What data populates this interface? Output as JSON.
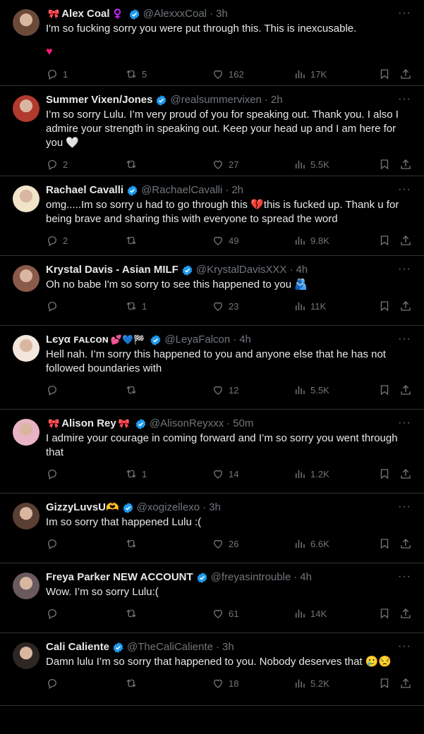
{
  "colors": {
    "background": "#000000",
    "text": "#e7e9ea",
    "muted": "#71767b",
    "verified": "#1d9bf0",
    "divider": "#2f3336",
    "heart": "#f91880"
  },
  "tweets": [
    {
      "pre": "🎀",
      "name": "Alex Coal",
      "post": "♀️",
      "handle": "@AlexxxCoal",
      "dot": "·",
      "time": "3h",
      "text": "I'm so fucking sorry you were put through this. This is inexcusable.",
      "extra": "♥",
      "replies": "1",
      "retweets": "5",
      "likes": "162",
      "views": "17K",
      "avatar": "#6b4a3a"
    },
    {
      "pre": "",
      "name": "Summer Vixen/Jones",
      "post": "",
      "handle": "@realsummervixen",
      "dot": "·",
      "time": "2h",
      "text": "I’m so sorry Lulu. I’m very proud of you for speaking out. Thank you. I also I admire your strength in speaking out. Keep your head up and I am here for you 🤍",
      "extra": "",
      "replies": "2",
      "retweets": "",
      "likes": "27",
      "views": "5.5K",
      "avatar": "#b03a2e"
    },
    {
      "pre": "",
      "name": "Rachael Cavalli",
      "post": "",
      "handle": "@RachaelCavalli",
      "dot": "·",
      "time": "2h",
      "text": "omg.....Im so sorry u had to go through this 💔this is fucked up. Thank u for being brave and sharing this with everyone to spread the word",
      "extra": "",
      "replies": "2",
      "retweets": "",
      "likes": "49",
      "views": "9.8K",
      "avatar": "#f1e4c8"
    },
    {
      "pre": "",
      "name": "Krystal Davis - Asian MILF",
      "post": "",
      "handle": "@KrystalDavisXXX",
      "dot": "·",
      "time": "4h",
      "text": "Oh no babe I'm so sorry to see this happened to you 🫂",
      "extra": "",
      "replies": "",
      "retweets": "1",
      "likes": "23",
      "views": "11K",
      "avatar": "#8a5a4a"
    },
    {
      "pre": "",
      "name": "Lєуα ꜰᴀʟᴄᴏɴ",
      "post": "💕💙🏁",
      "handle": "@LeyaFalcon",
      "dot": "·",
      "time": "4h",
      "text": "Hell nah. I’m sorry this happened to you and anyone else that he has not followed boundaries with",
      "extra": "",
      "replies": "",
      "retweets": "",
      "likes": "12",
      "views": "5.5K",
      "avatar": "#f3e6dc"
    },
    {
      "pre": "🎀",
      "name": "Alison Rey",
      "post": "🎀",
      "handle": "@AlisonReyxxx",
      "dot": "·",
      "time": "50m",
      "text": "I admire your courage in coming forward and I’m so sorry you went through that",
      "extra": "",
      "replies": "",
      "retweets": "1",
      "likes": "14",
      "views": "1.2K",
      "avatar": "#e8b4c4"
    },
    {
      "pre": "",
      "name": "GizzyLuvsU🫶",
      "post": "",
      "handle": "@xogizellexo",
      "dot": "·",
      "time": "3h",
      "text": "Im so sorry that happened Lulu :(",
      "extra": "",
      "replies": "",
      "retweets": "",
      "likes": "26",
      "views": "6.6K",
      "avatar": "#5a4032"
    },
    {
      "pre": "",
      "name": "Freya Parker NEW ACCOUNT",
      "post": "",
      "handle": "@freyasintrouble",
      "dot": "·",
      "time": "4h",
      "text": "Wow. I’m so sorry Lulu:(",
      "extra": "",
      "replies": "",
      "retweets": "",
      "likes": "61",
      "views": "14K",
      "avatar": "#6a5a5e"
    },
    {
      "pre": "",
      "name": "Cali Caliente",
      "post": "",
      "handle": "@TheCaliCaliente",
      "dot": "·",
      "time": "3h",
      "text": "Damn lulu I’m so sorry that happened to you. Nobody deserves that 🥲😒",
      "extra": "",
      "replies": "",
      "retweets": "",
      "likes": "18",
      "views": "5.2K",
      "avatar": "#2e2622"
    }
  ],
  "icons": {
    "more": "more-icon",
    "reply": "reply-icon",
    "retweet": "retweet-icon",
    "like": "heart-icon",
    "views": "views-icon",
    "bookmark": "bookmark-icon",
    "share": "share-icon",
    "verified": "verified-badge-icon"
  },
  "more_glyph": "···"
}
